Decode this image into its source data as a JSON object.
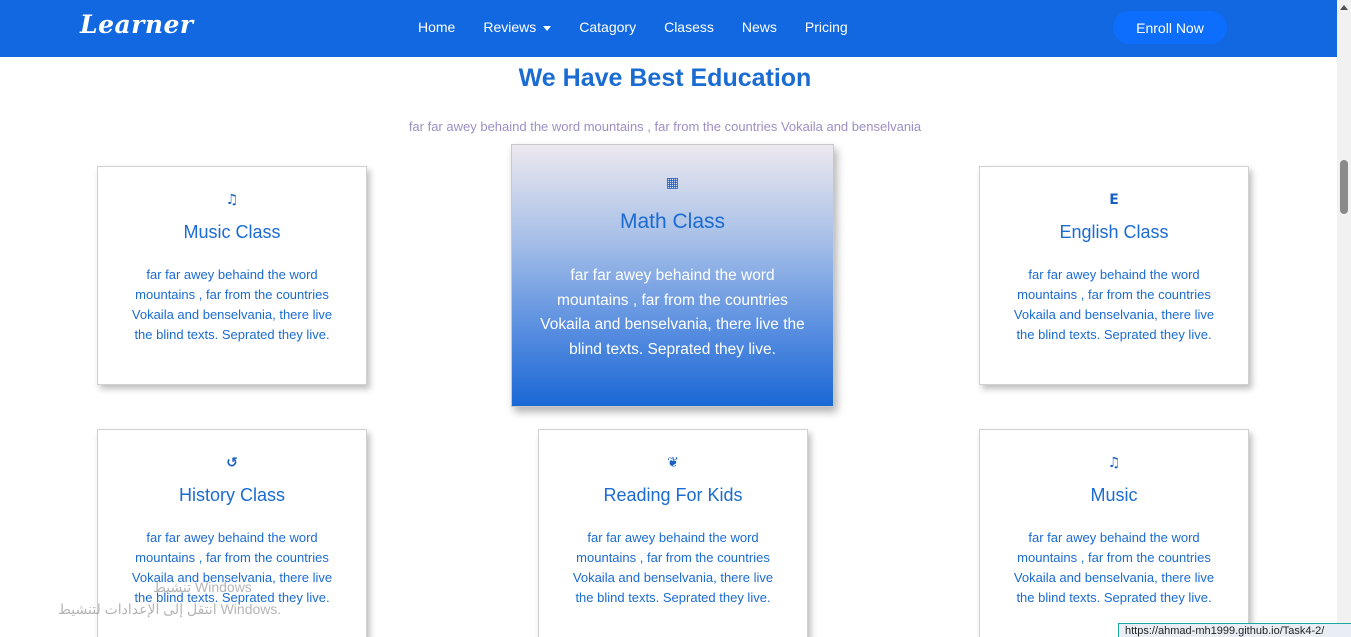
{
  "navbar": {
    "brand": "Learner",
    "links": [
      {
        "label": "Home"
      },
      {
        "label": "Reviews"
      },
      {
        "label": "Catagory"
      },
      {
        "label": "Clasess"
      },
      {
        "label": "News"
      },
      {
        "label": "Pricing"
      }
    ],
    "enroll_label": "Enroll Now"
  },
  "section": {
    "title": "We Have Best Education",
    "subtitle": "far far awey behaind the word mountains , far from the countries Vokaila and benselvania"
  },
  "cards": [
    {
      "icon": "music-note-icon",
      "glyph": "♫",
      "title": "Music Class",
      "text": "far far awey behaind the word mountains , far from the countries Vokaila and benselvania, there live the blind texts. Seprated they live."
    },
    {
      "icon": "calculator-icon",
      "glyph": "▦",
      "title": "Math Class",
      "text": "far far awey behaind the word mountains , far from the countries Vokaila and benselvania, there live the blind texts. Seprated they live."
    },
    {
      "icon": "letter-e-icon",
      "glyph": "E",
      "title": "English Class",
      "text": "far far awey behaind the word mountains , far from the countries Vokaila and benselvania, there live the blind texts. Seprated they live."
    },
    {
      "icon": "history-icon",
      "glyph": "↺",
      "title": "History Class",
      "text": "far far awey behaind the word mountains , far from the countries Vokaila and benselvania, there live the blind texts. Seprated they live."
    },
    {
      "icon": "hands-heart-icon",
      "glyph": "❦",
      "title": "Reading For Kids",
      "text": "far far awey behaind the word mountains , far from the countries Vokaila and benselvania, there live the blind texts. Seprated they live."
    },
    {
      "icon": "music-note-icon",
      "glyph": "♫",
      "title": "Music",
      "text": "far far awey behaind the word mountains , far from the countries Vokaila and benselvania, there live the blind texts. Seprated they live."
    }
  ],
  "watermark": {
    "line1": "تنشيط Windows",
    "line2": "انتقل إلى الإعدادات لتنشيط Windows."
  },
  "status_url": "https://ahmad-mh1999.github.io/Task4-2/",
  "colors": {
    "navbar": "#1168e0",
    "accent": "#1a6bd2",
    "subtitle": "#9c8fc5"
  }
}
